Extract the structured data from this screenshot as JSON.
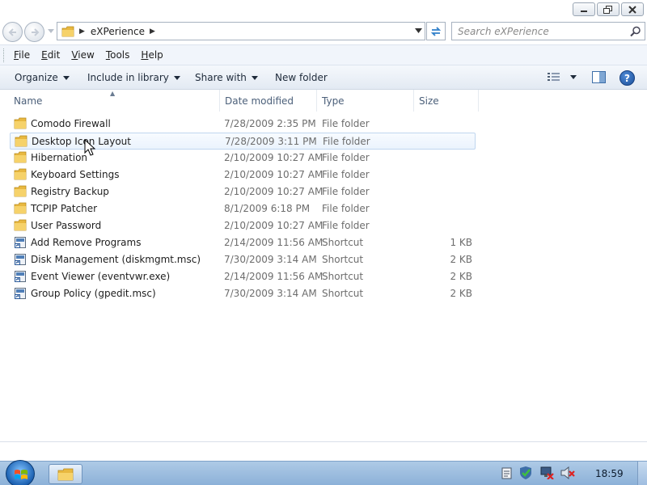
{
  "window": {
    "caption": {
      "minimize_icon": "minimize-icon",
      "restore_icon": "restore-icon",
      "close_icon": "close-icon"
    }
  },
  "address": {
    "crumb": "eXPerience",
    "search_placeholder": "Search eXPerience"
  },
  "menu": {
    "items": [
      {
        "accel": "F",
        "rest": "ile"
      },
      {
        "accel": "E",
        "rest": "dit"
      },
      {
        "accel": "V",
        "rest": "iew"
      },
      {
        "accel": "T",
        "rest": "ools"
      },
      {
        "accel": "H",
        "rest": "elp"
      }
    ]
  },
  "commands": {
    "organize": "Organize",
    "include": "Include in library",
    "share": "Share with",
    "new_folder": "New folder"
  },
  "columns": {
    "name": "Name",
    "date": "Date modified",
    "type": "Type",
    "size": "Size"
  },
  "files": [
    {
      "name": "Comodo Firewall",
      "date": "7/28/2009 2:35 PM",
      "type": "File folder",
      "size": "",
      "icon": "folder-icon"
    },
    {
      "name": "Desktop Icon Layout",
      "date": "7/28/2009 3:11 PM",
      "type": "File folder",
      "size": "",
      "icon": "folder-icon",
      "selected": true
    },
    {
      "name": "Hibernation",
      "date": "2/10/2009 10:27 AM",
      "type": "File folder",
      "size": "",
      "icon": "folder-icon"
    },
    {
      "name": "Keyboard Settings",
      "date": "2/10/2009 10:27 AM",
      "type": "File folder",
      "size": "",
      "icon": "folder-icon"
    },
    {
      "name": "Registry Backup",
      "date": "2/10/2009 10:27 AM",
      "type": "File folder",
      "size": "",
      "icon": "folder-icon"
    },
    {
      "name": "TCPIP Patcher",
      "date": "8/1/2009 6:18 PM",
      "type": "File folder",
      "size": "",
      "icon": "folder-icon"
    },
    {
      "name": "User Password",
      "date": "2/10/2009 10:27 AM",
      "type": "File folder",
      "size": "",
      "icon": "folder-icon"
    },
    {
      "name": "Add Remove Programs",
      "date": "2/14/2009 11:56 AM",
      "type": "Shortcut",
      "size": "1 KB",
      "icon": "shortcut-icon"
    },
    {
      "name": "Disk Management (diskmgmt.msc)",
      "date": "7/30/2009 3:14 AM",
      "type": "Shortcut",
      "size": "2 KB",
      "icon": "shortcut-icon"
    },
    {
      "name": "Event Viewer (eventvwr.exe)",
      "date": "2/14/2009 11:56 AM",
      "type": "Shortcut",
      "size": "2 KB",
      "icon": "shortcut-icon"
    },
    {
      "name": "Group Policy (gpedit.msc)",
      "date": "7/30/2009 3:14 AM",
      "type": "Shortcut",
      "size": "2 KB",
      "icon": "shortcut-icon"
    }
  ],
  "taskbar": {
    "clock": "18:59",
    "colors": {
      "accent": "#8cb1d8",
      "selection": "#ebf3fd",
      "folder": "#e8b840"
    }
  }
}
